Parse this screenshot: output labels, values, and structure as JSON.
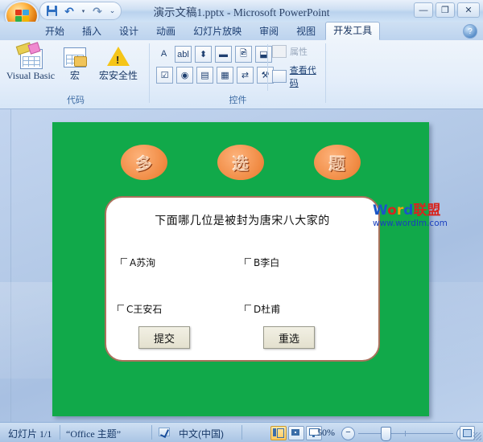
{
  "window": {
    "title": "演示文稿1.pptx - Microsoft PowerPoint",
    "minimize_label": "—",
    "restore_label": "❐",
    "close_label": "✕",
    "office_button": "office-orb"
  },
  "quick_access": {
    "save_label": "保存",
    "undo_label": "撤销",
    "undo_caret": "▾",
    "redo_label": "恢复",
    "customize_label": "⌄"
  },
  "tabs": [
    {
      "label": "开始",
      "active": false
    },
    {
      "label": "插入",
      "active": false
    },
    {
      "label": "设计",
      "active": false
    },
    {
      "label": "动画",
      "active": false
    },
    {
      "label": "幻灯片放映",
      "active": false
    },
    {
      "label": "审阅",
      "active": false
    },
    {
      "label": "视图",
      "active": false
    },
    {
      "label": "开发工具",
      "active": true
    }
  ],
  "help_button": "?",
  "ribbon": {
    "groups": [
      {
        "label": "代码",
        "buttons": [
          {
            "label": "Visual Basic",
            "icon": "visual-basic-icon"
          },
          {
            "label": "宏",
            "icon": "macro-icon"
          },
          {
            "label": "宏安全性",
            "icon": "macro-security-icon"
          }
        ]
      },
      {
        "label": "控件",
        "small_buttons_row1": [
          "A",
          "abl",
          "⬍",
          "▬",
          "🖻",
          "⬓"
        ],
        "small_buttons_row2": [
          "☑",
          "◉",
          "▤",
          "▦",
          "⇄",
          "⚒"
        ],
        "properties_label": "属性",
        "properties_disabled": true,
        "view_code_label": "查看代码"
      }
    ]
  },
  "slide": {
    "background_color": "#11a94a",
    "title_bubbles": [
      "多",
      "选",
      "题"
    ],
    "question": "下面哪几位是被封为唐宋八大家的",
    "options": [
      {
        "id": "A",
        "text": "A苏洵",
        "checked": false
      },
      {
        "id": "B",
        "text": "B李白",
        "checked": false
      },
      {
        "id": "C",
        "text": "C王安石",
        "checked": false
      },
      {
        "id": "D",
        "text": "D杜甫",
        "checked": false
      }
    ],
    "submit_label": "提交",
    "reset_label": "重选"
  },
  "watermark": {
    "w": "W",
    "o": "o",
    "r": "r",
    "d": "d",
    "cn": "联盟",
    "url": "www.wordlm.com"
  },
  "status_bar": {
    "slide_counter": "幻灯片 1/1",
    "theme": "“Office 主题”",
    "spell_icon": "spell-check-icon",
    "language": "中文(中国)",
    "view_normal": "普通视图",
    "view_sorter": "幻灯片浏览",
    "view_show": "幻灯片放映",
    "zoom_level": "50%",
    "zoom_out": "−",
    "zoom_in": "+",
    "fit_label": "适应窗口"
  }
}
